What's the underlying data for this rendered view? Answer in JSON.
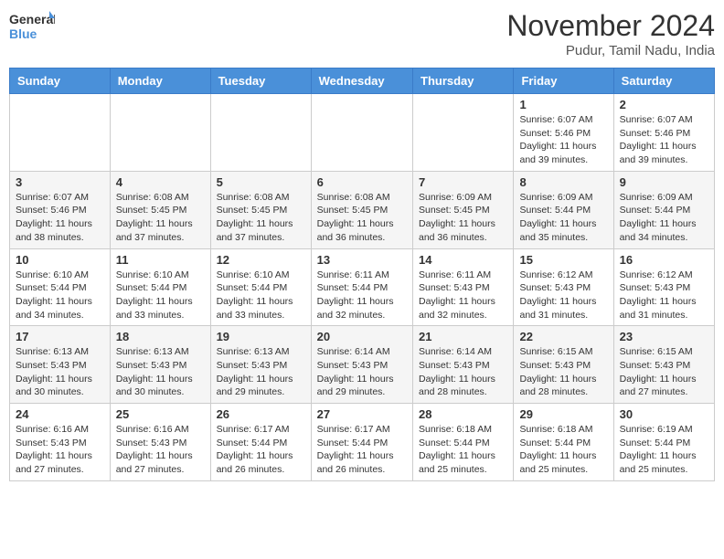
{
  "header": {
    "logo_line1": "General",
    "logo_line2": "Blue",
    "month": "November 2024",
    "location": "Pudur, Tamil Nadu, India"
  },
  "weekdays": [
    "Sunday",
    "Monday",
    "Tuesday",
    "Wednesday",
    "Thursday",
    "Friday",
    "Saturday"
  ],
  "weeks": [
    [
      {
        "day": "",
        "info": ""
      },
      {
        "day": "",
        "info": ""
      },
      {
        "day": "",
        "info": ""
      },
      {
        "day": "",
        "info": ""
      },
      {
        "day": "",
        "info": ""
      },
      {
        "day": "1",
        "info": "Sunrise: 6:07 AM\nSunset: 5:46 PM\nDaylight: 11 hours and 39 minutes."
      },
      {
        "day": "2",
        "info": "Sunrise: 6:07 AM\nSunset: 5:46 PM\nDaylight: 11 hours and 39 minutes."
      }
    ],
    [
      {
        "day": "3",
        "info": "Sunrise: 6:07 AM\nSunset: 5:46 PM\nDaylight: 11 hours and 38 minutes."
      },
      {
        "day": "4",
        "info": "Sunrise: 6:08 AM\nSunset: 5:45 PM\nDaylight: 11 hours and 37 minutes."
      },
      {
        "day": "5",
        "info": "Sunrise: 6:08 AM\nSunset: 5:45 PM\nDaylight: 11 hours and 37 minutes."
      },
      {
        "day": "6",
        "info": "Sunrise: 6:08 AM\nSunset: 5:45 PM\nDaylight: 11 hours and 36 minutes."
      },
      {
        "day": "7",
        "info": "Sunrise: 6:09 AM\nSunset: 5:45 PM\nDaylight: 11 hours and 36 minutes."
      },
      {
        "day": "8",
        "info": "Sunrise: 6:09 AM\nSunset: 5:44 PM\nDaylight: 11 hours and 35 minutes."
      },
      {
        "day": "9",
        "info": "Sunrise: 6:09 AM\nSunset: 5:44 PM\nDaylight: 11 hours and 34 minutes."
      }
    ],
    [
      {
        "day": "10",
        "info": "Sunrise: 6:10 AM\nSunset: 5:44 PM\nDaylight: 11 hours and 34 minutes."
      },
      {
        "day": "11",
        "info": "Sunrise: 6:10 AM\nSunset: 5:44 PM\nDaylight: 11 hours and 33 minutes."
      },
      {
        "day": "12",
        "info": "Sunrise: 6:10 AM\nSunset: 5:44 PM\nDaylight: 11 hours and 33 minutes."
      },
      {
        "day": "13",
        "info": "Sunrise: 6:11 AM\nSunset: 5:44 PM\nDaylight: 11 hours and 32 minutes."
      },
      {
        "day": "14",
        "info": "Sunrise: 6:11 AM\nSunset: 5:43 PM\nDaylight: 11 hours and 32 minutes."
      },
      {
        "day": "15",
        "info": "Sunrise: 6:12 AM\nSunset: 5:43 PM\nDaylight: 11 hours and 31 minutes."
      },
      {
        "day": "16",
        "info": "Sunrise: 6:12 AM\nSunset: 5:43 PM\nDaylight: 11 hours and 31 minutes."
      }
    ],
    [
      {
        "day": "17",
        "info": "Sunrise: 6:13 AM\nSunset: 5:43 PM\nDaylight: 11 hours and 30 minutes."
      },
      {
        "day": "18",
        "info": "Sunrise: 6:13 AM\nSunset: 5:43 PM\nDaylight: 11 hours and 30 minutes."
      },
      {
        "day": "19",
        "info": "Sunrise: 6:13 AM\nSunset: 5:43 PM\nDaylight: 11 hours and 29 minutes."
      },
      {
        "day": "20",
        "info": "Sunrise: 6:14 AM\nSunset: 5:43 PM\nDaylight: 11 hours and 29 minutes."
      },
      {
        "day": "21",
        "info": "Sunrise: 6:14 AM\nSunset: 5:43 PM\nDaylight: 11 hours and 28 minutes."
      },
      {
        "day": "22",
        "info": "Sunrise: 6:15 AM\nSunset: 5:43 PM\nDaylight: 11 hours and 28 minutes."
      },
      {
        "day": "23",
        "info": "Sunrise: 6:15 AM\nSunset: 5:43 PM\nDaylight: 11 hours and 27 minutes."
      }
    ],
    [
      {
        "day": "24",
        "info": "Sunrise: 6:16 AM\nSunset: 5:43 PM\nDaylight: 11 hours and 27 minutes."
      },
      {
        "day": "25",
        "info": "Sunrise: 6:16 AM\nSunset: 5:43 PM\nDaylight: 11 hours and 27 minutes."
      },
      {
        "day": "26",
        "info": "Sunrise: 6:17 AM\nSunset: 5:44 PM\nDaylight: 11 hours and 26 minutes."
      },
      {
        "day": "27",
        "info": "Sunrise: 6:17 AM\nSunset: 5:44 PM\nDaylight: 11 hours and 26 minutes."
      },
      {
        "day": "28",
        "info": "Sunrise: 6:18 AM\nSunset: 5:44 PM\nDaylight: 11 hours and 25 minutes."
      },
      {
        "day": "29",
        "info": "Sunrise: 6:18 AM\nSunset: 5:44 PM\nDaylight: 11 hours and 25 minutes."
      },
      {
        "day": "30",
        "info": "Sunrise: 6:19 AM\nSunset: 5:44 PM\nDaylight: 11 hours and 25 minutes."
      }
    ]
  ]
}
